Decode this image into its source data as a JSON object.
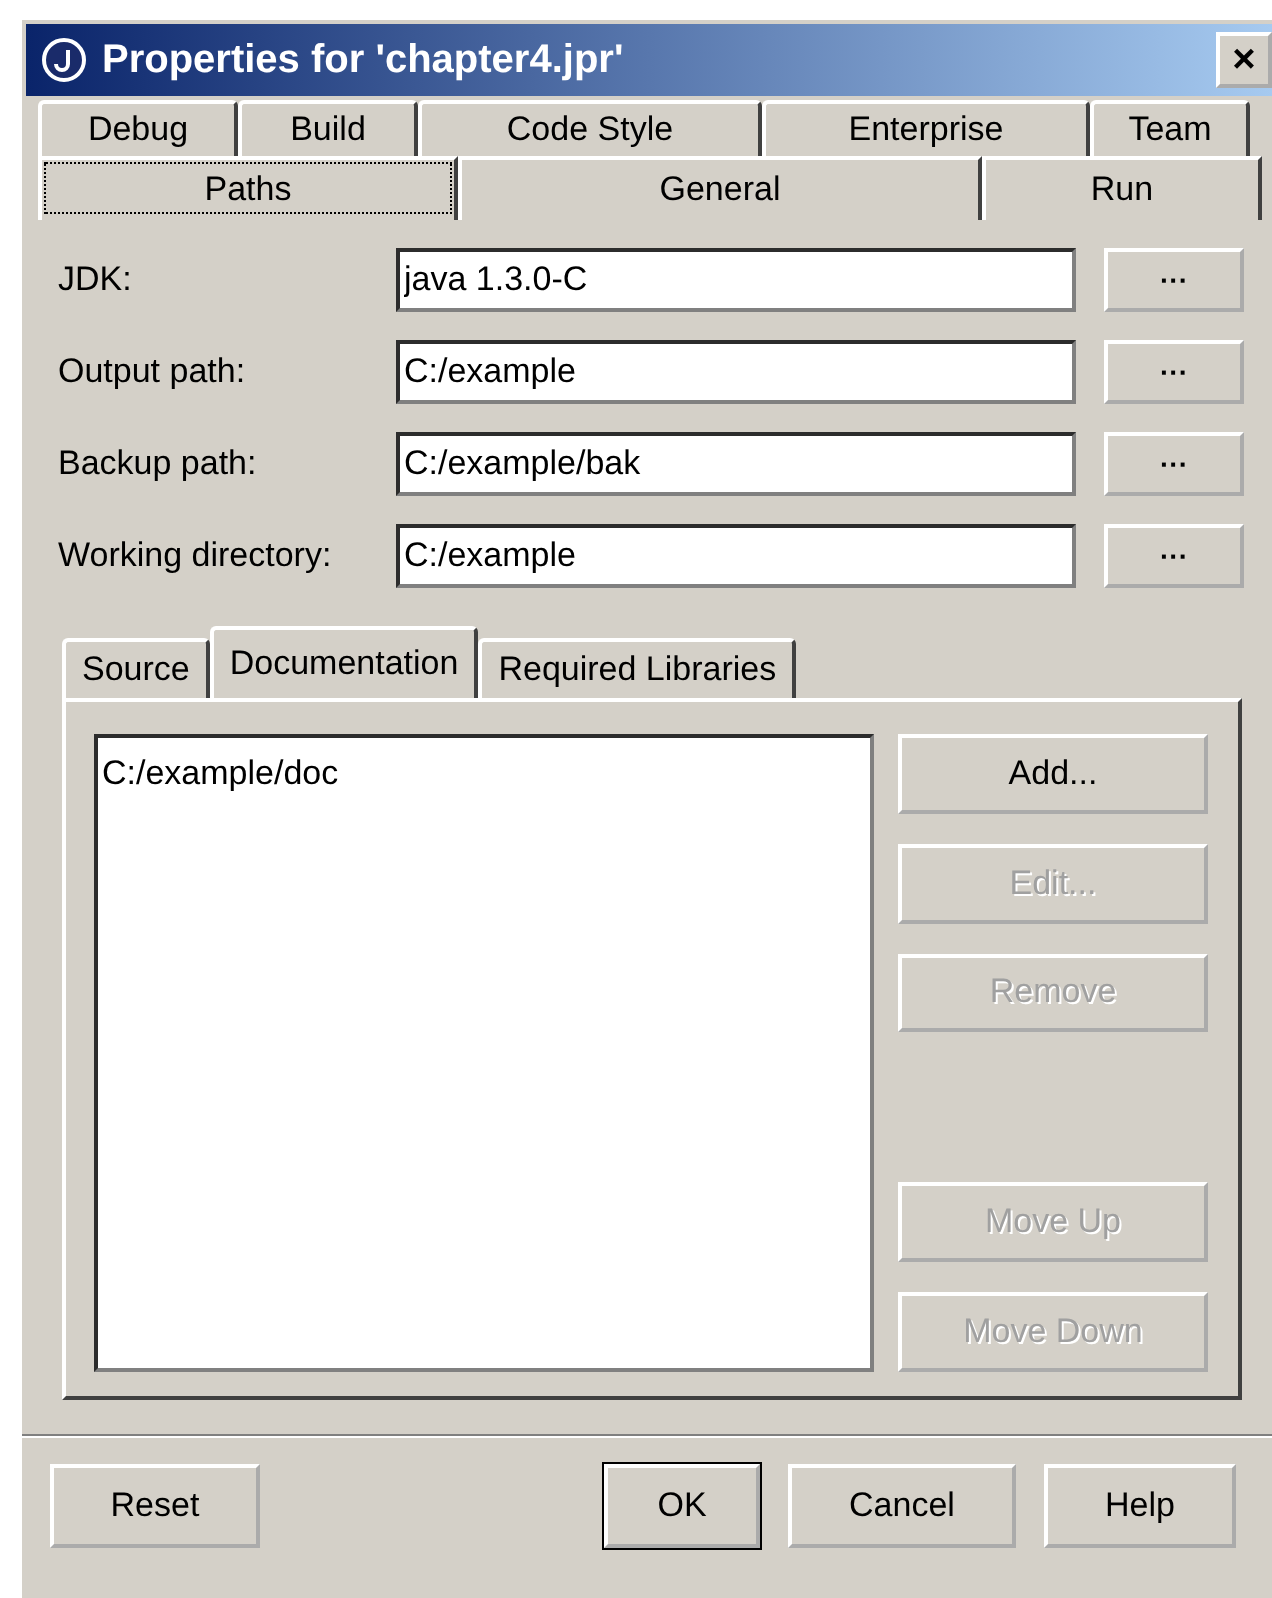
{
  "window": {
    "title": "Properties for 'chapter4.jpr'",
    "close": "×"
  },
  "tabs_back": [
    {
      "label": "Debug",
      "selected": false
    },
    {
      "label": "Build",
      "selected": false
    },
    {
      "label": "Code Style",
      "selected": false
    },
    {
      "label": "Enterprise",
      "selected": false
    },
    {
      "label": "Team",
      "selected": false
    }
  ],
  "tabs_front": [
    {
      "label": "Paths",
      "selected": true
    },
    {
      "label": "General",
      "selected": false
    },
    {
      "label": "Run",
      "selected": false
    }
  ],
  "fields": [
    {
      "label": "JDK:",
      "value": "java 1.3.0-C",
      "button": "···"
    },
    {
      "label": "Output path:",
      "value": "C:/example",
      "button": "···"
    },
    {
      "label": "Backup path:",
      "value": "C:/example/bak",
      "button": "···"
    },
    {
      "label": "Working directory:",
      "value": "C:/example",
      "button": "···"
    }
  ],
  "subtabs": [
    {
      "label": "Source",
      "selected": false
    },
    {
      "label": "Documentation",
      "selected": true
    },
    {
      "label": "Required Libraries",
      "selected": false
    }
  ],
  "list_items": [
    "C:/example/doc"
  ],
  "side_buttons": [
    {
      "label": "Add...",
      "disabled": false
    },
    {
      "label": "Edit...",
      "disabled": true
    },
    {
      "label": "Remove",
      "disabled": true
    },
    {
      "label": "Move Up",
      "disabled": true
    },
    {
      "label": "Move Down",
      "disabled": true
    }
  ],
  "footer": {
    "left": [
      {
        "label": "Reset",
        "default": false
      }
    ],
    "right": [
      {
        "label": "OK",
        "default": true
      },
      {
        "label": "Cancel",
        "default": false
      },
      {
        "label": "Help",
        "default": false
      }
    ]
  }
}
